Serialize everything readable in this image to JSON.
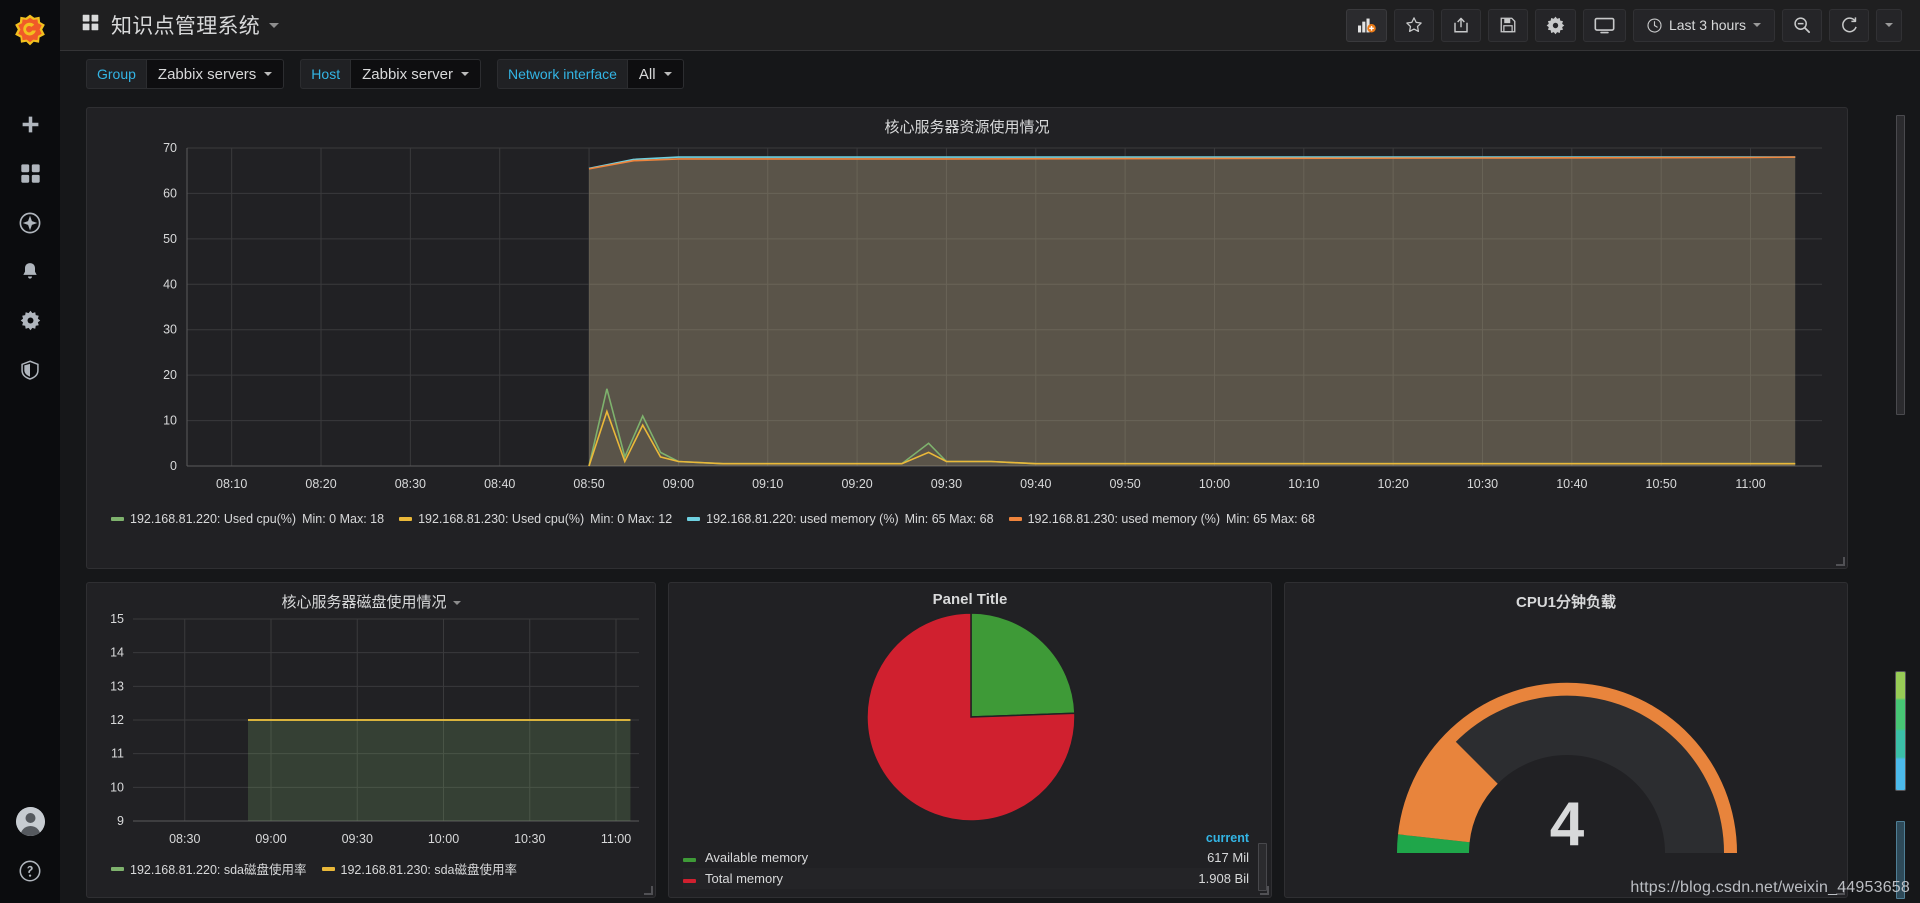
{
  "app": {
    "logo": "grafana-logo",
    "dashboard_title": "知识点管理系统"
  },
  "toolbar": {
    "add_panel_label": "add-panel-icon",
    "star_label": "star-icon",
    "share_label": "share-icon",
    "save_label": "save-icon",
    "settings_label": "gear-icon",
    "tv_label": "tv-icon",
    "time_range": "Last 3 hours",
    "zoom_out_label": "zoom-out-icon",
    "refresh_label": "refresh-icon"
  },
  "sidebar": {
    "items": [
      {
        "name": "create-icon",
        "label": "Create"
      },
      {
        "name": "dashboards-icon",
        "label": "Dashboards"
      },
      {
        "name": "explore-icon",
        "label": "Explore"
      },
      {
        "name": "alerting-icon",
        "label": "Alerting"
      },
      {
        "name": "configuration-icon",
        "label": "Configuration"
      },
      {
        "name": "shield-icon",
        "label": "Server Admin"
      }
    ],
    "bottom": [
      {
        "name": "avatar",
        "label": "User"
      },
      {
        "name": "help-icon",
        "label": "Help"
      }
    ]
  },
  "template_variables": [
    {
      "label": "Group",
      "value": "Zabbix servers"
    },
    {
      "label": "Host",
      "value": "Zabbix server"
    },
    {
      "label": "Network interface",
      "value": "All"
    }
  ],
  "panels": {
    "resource": {
      "title": "核心服务器资源使用情况"
    },
    "disk": {
      "title": "核心服务器磁盘使用情况"
    },
    "pie": {
      "title": "Panel Title",
      "legend_header": "current",
      "rows": [
        {
          "label": "Available memory",
          "value": "617 Mil",
          "color": "#3e9a37"
        },
        {
          "label": "Total memory",
          "value": "1.908 Bil",
          "color": "#d0202f"
        }
      ]
    },
    "gauge": {
      "title": "CPU1分钟负载",
      "value": "4"
    }
  },
  "watermark": "https://blog.csdn.net/weixin_44953658",
  "colors": {
    "green": "#7eb26d",
    "yellow": "#eab839",
    "blue": "#6ed0e0",
    "orange": "#ef843c",
    "accent_blue": "#33b5e5",
    "pie_green": "#3e9a37",
    "pie_red": "#d0202f",
    "gauge_orange": "#e8843c",
    "gauge_green": "#1fa64a"
  },
  "chart_data": [
    {
      "id": "resource-graph",
      "type": "line",
      "title": "核心服务器资源使用情况",
      "xlabel": "",
      "ylabel": "",
      "ylim": [
        0,
        70
      ],
      "yticks": [
        0,
        10,
        20,
        30,
        40,
        50,
        60,
        70
      ],
      "xticks": [
        "08:10",
        "08:20",
        "08:30",
        "08:40",
        "08:50",
        "09:00",
        "09:10",
        "09:20",
        "09:30",
        "09:40",
        "09:50",
        "10:00",
        "10:10",
        "10:20",
        "10:30",
        "10:40",
        "10:50",
        "11:00"
      ],
      "grid": true,
      "legend_position": "bottom",
      "series": [
        {
          "name": "192.168.81.220: Used cpu(%)",
          "color": "#7eb26d",
          "min": 0,
          "max": 18,
          "stats_text": "Min: 0  Max: 18",
          "x": [
            "08:50",
            "08:52",
            "08:54",
            "08:56",
            "08:58",
            "09:00",
            "09:05",
            "09:10",
            "09:15",
            "09:20",
            "09:25",
            "09:28",
            "09:30",
            "09:35",
            "09:40",
            "10:00",
            "10:30",
            "11:00",
            "11:05"
          ],
          "values": [
            0,
            17,
            2,
            11,
            3,
            1,
            0.5,
            0.5,
            0.5,
            0.5,
            0.5,
            5,
            1,
            1,
            0.5,
            0.5,
            0.5,
            0.5,
            0.5
          ]
        },
        {
          "name": "192.168.81.230: Used cpu(%)",
          "color": "#eab839",
          "min": 0,
          "max": 12,
          "stats_text": "Min: 0  Max: 12",
          "x": [
            "08:50",
            "08:52",
            "08:54",
            "08:56",
            "08:58",
            "09:00",
            "09:05",
            "09:10",
            "09:15",
            "09:20",
            "09:25",
            "09:28",
            "09:30",
            "09:35",
            "09:40",
            "10:00",
            "10:30",
            "11:00",
            "11:05"
          ],
          "values": [
            0,
            12,
            1,
            9,
            2,
            1,
            0.5,
            0.5,
            0.5,
            0.5,
            0.5,
            3,
            1,
            1,
            0.5,
            0.5,
            0.5,
            0.5,
            0.5
          ]
        },
        {
          "name": "192.168.81.220: used memory (%)",
          "color": "#6ed0e0",
          "min": 65,
          "max": 68,
          "stats_text": "Min: 65  Max: 68",
          "x": [
            "08:50",
            "08:55",
            "09:00",
            "09:30",
            "10:00",
            "10:30",
            "11:00",
            "11:05"
          ],
          "values": [
            65.5,
            67.5,
            68,
            68,
            68,
            68,
            68,
            68
          ]
        },
        {
          "name": "192.168.81.230: used memory (%)",
          "color": "#ef843c",
          "min": 65,
          "max": 68,
          "stats_text": "Min: 65  Max: 68",
          "x": [
            "08:50",
            "08:55",
            "09:00",
            "09:30",
            "10:00",
            "10:30",
            "11:00",
            "11:05"
          ],
          "values": [
            65.4,
            67.2,
            67.6,
            67.6,
            67.7,
            67.8,
            67.9,
            68
          ]
        }
      ]
    },
    {
      "id": "disk-graph",
      "type": "line",
      "title": "核心服务器磁盘使用情况",
      "ylim": [
        9,
        15
      ],
      "yticks": [
        9,
        10,
        11,
        12,
        13,
        14,
        15
      ],
      "xticks": [
        "08:30",
        "09:00",
        "09:30",
        "10:00",
        "10:30",
        "11:00"
      ],
      "grid": true,
      "legend_position": "bottom",
      "series": [
        {
          "name": "192.168.81.220: sda磁盘使用率",
          "color": "#7eb26d",
          "x": [
            "08:52",
            "09:00",
            "09:30",
            "10:00",
            "10:30",
            "11:00",
            "11:05"
          ],
          "values": [
            12,
            12,
            12,
            12,
            12,
            12,
            12
          ]
        },
        {
          "name": "192.168.81.230: sda磁盘使用率",
          "color": "#eab839",
          "x": [
            "08:52",
            "09:00",
            "09:30",
            "10:00",
            "10:30",
            "11:00",
            "11:05"
          ],
          "values": [
            12,
            12,
            12,
            12,
            12,
            12,
            12
          ]
        }
      ]
    },
    {
      "id": "memory-pie",
      "type": "pie",
      "title": "Panel Title",
      "labels": [
        "Available memory",
        "Total memory"
      ],
      "values": [
        617,
        1908
      ],
      "display_values": [
        "617 Mil",
        "1.908 Bil"
      ],
      "percent": [
        24.4,
        75.6
      ],
      "colors": [
        "#3e9a37",
        "#d0202f"
      ],
      "legend_position": "bottom"
    },
    {
      "id": "cpu-load-gauge",
      "type": "gauge",
      "title": "CPU1分钟负载",
      "value": 4,
      "display_value": "4",
      "min": 0,
      "max": 16,
      "threshold_colors": [
        "#1fa64a",
        "#e8843c"
      ],
      "filled_fraction": 0.25
    }
  ]
}
